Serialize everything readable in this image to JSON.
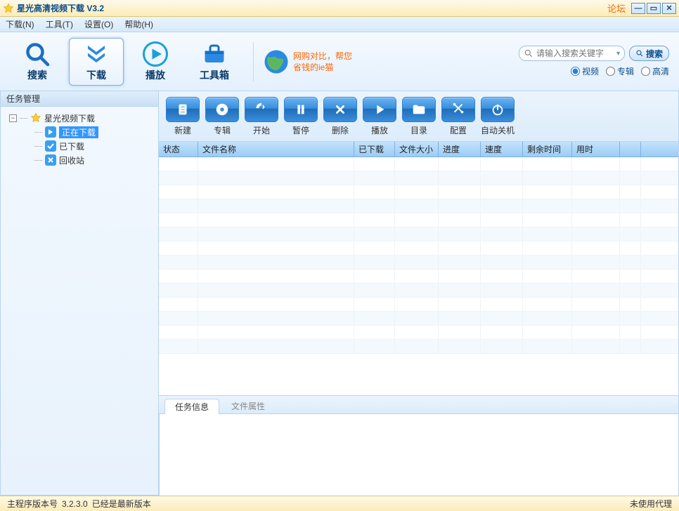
{
  "titlebar": {
    "title": "星光高清视频下载 V3.2",
    "forum": "论坛"
  },
  "menubar": {
    "items": [
      {
        "label": "下载(N)"
      },
      {
        "label": "工具(T)"
      },
      {
        "label": "设置(O)"
      },
      {
        "label": "帮助(H)"
      }
    ]
  },
  "toolbar": {
    "search": "搜索",
    "download": "下载",
    "play": "播放",
    "toolbox": "工具箱"
  },
  "promo": {
    "line1": "网购对比，帮您",
    "line2": "省钱的ie猫"
  },
  "search": {
    "placeholder": "请输入搜索关键字",
    "button": "搜索",
    "radios": {
      "video": "视频",
      "album": "专辑",
      "hd": "高清"
    },
    "selected": "video"
  },
  "sidebar": {
    "header": "任务管理",
    "root": "星光视频下载",
    "items": [
      {
        "label": "正在下载",
        "selected": true
      },
      {
        "label": "已下载"
      },
      {
        "label": "回收站"
      }
    ]
  },
  "actions": {
    "new": "新建",
    "album": "专辑",
    "start": "开始",
    "pause": "暂停",
    "delete": "删除",
    "play": "播放",
    "directory": "目录",
    "config": "配置",
    "shutdown": "自动关机"
  },
  "table": {
    "columns": [
      "状态",
      "文件名称",
      "已下载",
      "文件大小",
      "进度",
      "速度",
      "剩余时间",
      "用时",
      ""
    ]
  },
  "tabs": {
    "task_info": "任务信息",
    "file_props": "文件属性"
  },
  "statusbar": {
    "version_label": "主程序版本号",
    "version": "3.2.3.0",
    "latest": "已经是最新版本",
    "proxy": "未使用代理"
  }
}
